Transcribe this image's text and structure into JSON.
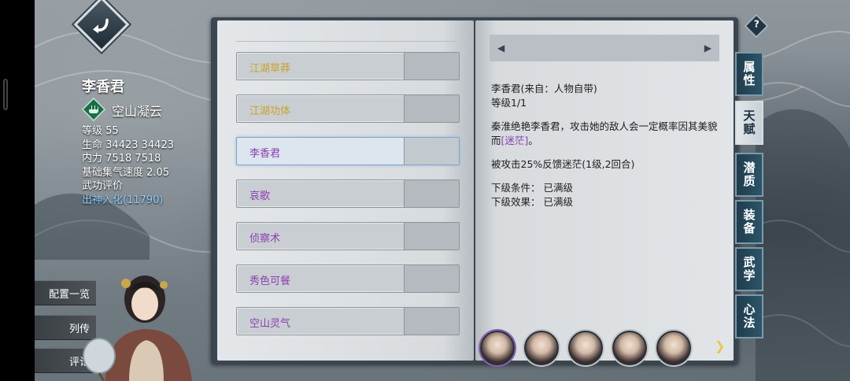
{
  "character": {
    "name": "李香君",
    "sect": "空山凝云",
    "stats": [
      {
        "label": "等级",
        "value": "55"
      },
      {
        "label": "生命",
        "value": "34423 34423"
      },
      {
        "label": "内力",
        "value": "7518 7518"
      },
      {
        "label": "基础集气速度",
        "value": "2.05"
      }
    ],
    "rating_label": "武功评价",
    "rating_value": "出神入化(11790)"
  },
  "side_menu": [
    "配置一览",
    "列传",
    "评论"
  ],
  "skills": [
    {
      "name": "江湖草莽",
      "color": "#c9a227"
    },
    {
      "name": "江湖功体",
      "color": "#c9a227"
    },
    {
      "name": "李香君",
      "color": "#8a3fb0",
      "selected": true
    },
    {
      "name": "哀歌",
      "color": "#8a3fb0"
    },
    {
      "name": "侦察术",
      "color": "#8a3fb0"
    },
    {
      "name": "秀色可餐",
      "color": "#8a3fb0"
    },
    {
      "name": "空山灵气",
      "color": "#8a3fb0"
    }
  ],
  "detail": {
    "title": "李香君(来自：人物自带)",
    "level": "等级1/1",
    "desc_prefix": "秦淮绝艳李香君，攻击她的敌人会一定概率因其美貌而",
    "desc_highlight": "[迷茫]",
    "desc_suffix": "。",
    "effect": "被攻击25%反馈迷茫(1级,2回合)",
    "next_condition_label": "下级条件：",
    "next_condition_value": "已满级",
    "next_effect_label": "下级效果：",
    "next_effect_value": "已满级"
  },
  "tabs": [
    {
      "label": "属性",
      "active": false
    },
    {
      "label": "天赋",
      "active": true
    },
    {
      "label": "潜质",
      "active": false
    },
    {
      "label": "装备",
      "active": false
    },
    {
      "label": "武学",
      "active": false
    },
    {
      "label": "心法",
      "active": false
    }
  ],
  "help_label": "?",
  "icons": {
    "back": "back-arrow-icon",
    "sect": "fist-icon",
    "prev": "chevron-left-icon",
    "next": "chevron-right-icon"
  }
}
